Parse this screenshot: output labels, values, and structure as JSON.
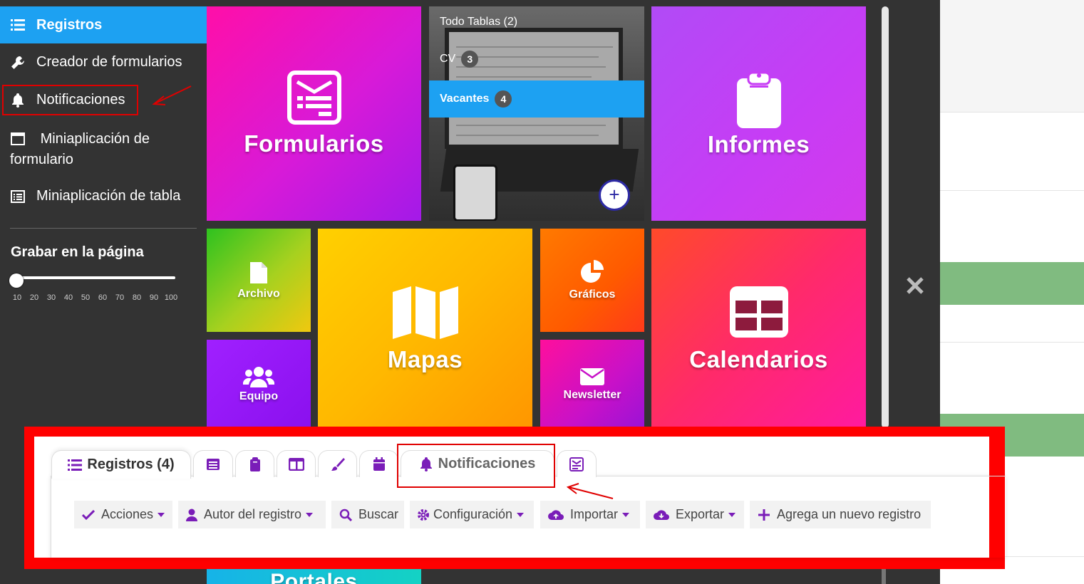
{
  "sidebar": {
    "items": [
      {
        "label": "Registros",
        "icon": "list-icon",
        "active": true
      },
      {
        "label": "Creador de formularios",
        "icon": "wrench-icon"
      },
      {
        "label": "Notificaciones",
        "icon": "bell-icon"
      },
      {
        "label": "Miniaplicación de formulario",
        "icon": "window-icon"
      },
      {
        "label": "Miniaplicación de tabla",
        "icon": "table-list-icon"
      }
    ],
    "grabar_title": "Grabar en la página",
    "slider": {
      "value": 10,
      "min": 10,
      "max": 100
    },
    "ticks": [
      "10",
      "20",
      "30",
      "40",
      "50",
      "60",
      "70",
      "80",
      "90",
      "100"
    ]
  },
  "tiles": {
    "formularios": "Formularios",
    "informes": "Informes",
    "archivo": "Archivo",
    "graficos": "Gráficos",
    "mapas": "Mapas",
    "calendarios": "Calendarios",
    "equipo": "Equipo",
    "newsletter": "Newsletter",
    "portales": "Portales"
  },
  "laptop_tile": {
    "title": "Todo Tablas (2)",
    "rows": [
      {
        "label": "CV",
        "count": "3"
      },
      {
        "label": "Vacantes",
        "count": "4"
      }
    ],
    "add_label": "+"
  },
  "panel": {
    "active_tab": "Registros (4)",
    "notif_tab": "Notificaciones",
    "tab_icons": [
      "list-icon",
      "table-icon",
      "clipboard-icon",
      "columns-icon",
      "brush-icon",
      "calendar-icon",
      "bell-icon",
      "newsletter-icon"
    ],
    "buttons": [
      "Acciones",
      "Autor del registro",
      "Buscar",
      "Configuración",
      "Importar",
      "Exportar",
      "Agrega un nuevo registro"
    ]
  },
  "colors": {
    "accent": "#1da1f2",
    "purple": "#7a1db8",
    "highlight": "#e00000",
    "panel_border": "#ff0000"
  }
}
